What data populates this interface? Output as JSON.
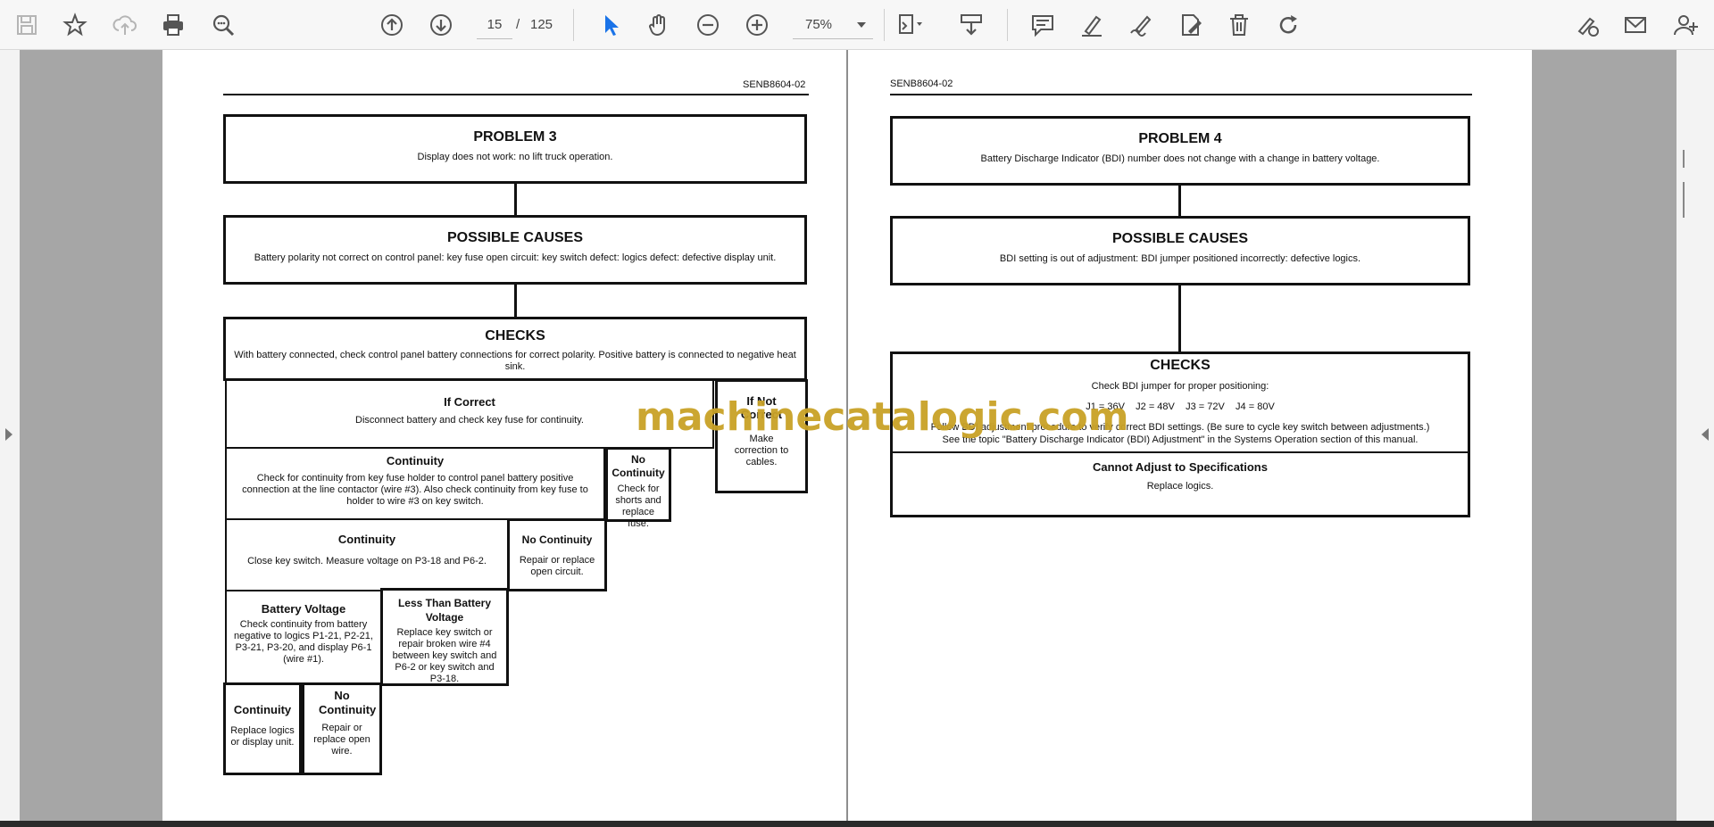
{
  "toolbar": {
    "page_current": "15",
    "page_separator": "/",
    "page_total": "125",
    "zoom": "75%",
    "icons": [
      "save-icon",
      "bookmark-star-icon",
      "upload-cloud-icon",
      "print-icon",
      "find-zoom-icon",
      "page-up-icon",
      "page-down-icon",
      "select-pointer-icon",
      "hand-pan-icon",
      "zoom-out-icon",
      "zoom-in-icon",
      "fit-page-icon",
      "page-scroll-icon",
      "comment-icon",
      "highlight-pen-icon",
      "draw-icon",
      "edit-sign-icon",
      "delete-icon",
      "rotate-icon",
      "fill-sign-icon",
      "email-icon",
      "add-user-icon"
    ],
    "accent": "#1a73e8"
  },
  "watermark": "machinecatalogic.com",
  "left_page": {
    "doc_code": "SENB8604-02",
    "problem": {
      "title": "PROBLEM 3",
      "text": "Display does not work: no lift truck operation."
    },
    "causes": {
      "title": "POSSIBLE CAUSES",
      "text": "Battery polarity not correct on control panel: key fuse open circuit: key switch defect: logics defect: defective display unit."
    },
    "checks": {
      "title": "CHECKS",
      "text": "With battery connected, check control panel battery connections for correct polarity. Positive battery is connected to negative heat sink."
    },
    "if_correct": {
      "title": "If Correct",
      "text": "Disconnect battery and check key fuse for continuity."
    },
    "if_not_correct": {
      "title": "If Not Correct",
      "text": "Make correction to cables."
    },
    "continuity1": {
      "title": "Continuity",
      "text": "Check for continuity from key fuse holder to control panel battery positive connection at the line contactor (wire #3). Also check continuity from key fuse to holder to wire #3 on key switch."
    },
    "no_continuity1": {
      "title": "No Continuity",
      "text": "Check for shorts and replace fuse."
    },
    "continuity2": {
      "title": "Continuity",
      "text": "Close key switch. Measure voltage on P3-18 and P6-2."
    },
    "no_continuity2": {
      "title": "No Continuity",
      "text": "Repair or replace open circuit."
    },
    "battery_voltage": {
      "title": "Battery Voltage",
      "text": "Check continuity from battery negative to logics P1-21, P2-21, P3-21, P3-20, and display P6-1 (wire #1)."
    },
    "less_than": {
      "title": "Less Than Battery Voltage",
      "text": "Replace key switch or repair broken wire #4 between key switch and P6-2 or key switch and P3-18."
    },
    "continuity3": {
      "title": "Continuity",
      "text": "Replace logics or display unit."
    },
    "no_continuity3": {
      "title": "No Continuity",
      "text": "Repair or replace open wire."
    }
  },
  "right_page": {
    "doc_code": "SENB8604-02",
    "problem": {
      "title": "PROBLEM 4",
      "text": "Battery Discharge Indicator (BDI) number does not change with a change in battery voltage."
    },
    "causes": {
      "title": "POSSIBLE CAUSES",
      "text": "BDI setting is out of adjustment: BDI jumper positioned incorrectly: defective logics."
    },
    "checks": {
      "title": "CHECKS",
      "line1": "Check BDI jumper for proper positioning:",
      "line2": "J1 = 36V    J2 = 48V    J3 = 72V    J4 = 80V",
      "line3": "Follow BDI adjustment procedure to verify correct BDI settings. (Be sure to cycle key switch between adjustments.)",
      "line4": "See the topic \"Battery Discharge Indicator (BDI) Adjustment\" in the Systems Operation section of this manual."
    },
    "cannot_adjust": {
      "title": "Cannot Adjust to Specifications",
      "text": "Replace logics."
    }
  }
}
